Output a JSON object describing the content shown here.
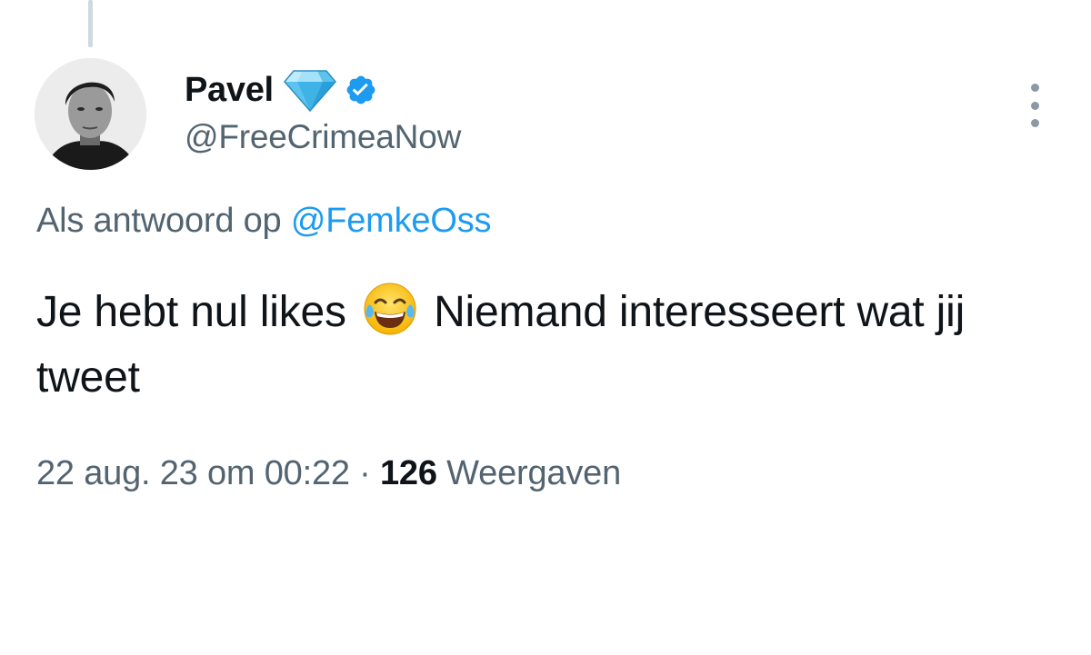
{
  "tweet": {
    "author": {
      "display_name": "Pavel",
      "handle": "@FreeCrimeaNow",
      "badges": [
        "diamond-icon",
        "verified-icon"
      ]
    },
    "reply_context": {
      "prefix": "Als antwoord op",
      "mention": "@FemkeOss"
    },
    "text": {
      "before_emoji": "Je hebt nul likes",
      "emoji": "face-with-tears-of-joy-icon",
      "after_emoji": "Niemand interesseert wat jij tweet"
    },
    "timestamp": "22 aug. 23 om 00:22",
    "separator": "·",
    "views": {
      "count": "126",
      "label": "Weergaven"
    }
  },
  "colors": {
    "text_primary": "#0f1419",
    "text_secondary": "#536471",
    "link": "#1d9bf0",
    "verified": "#1d9bf0",
    "thread_line": "#cfd9de"
  }
}
